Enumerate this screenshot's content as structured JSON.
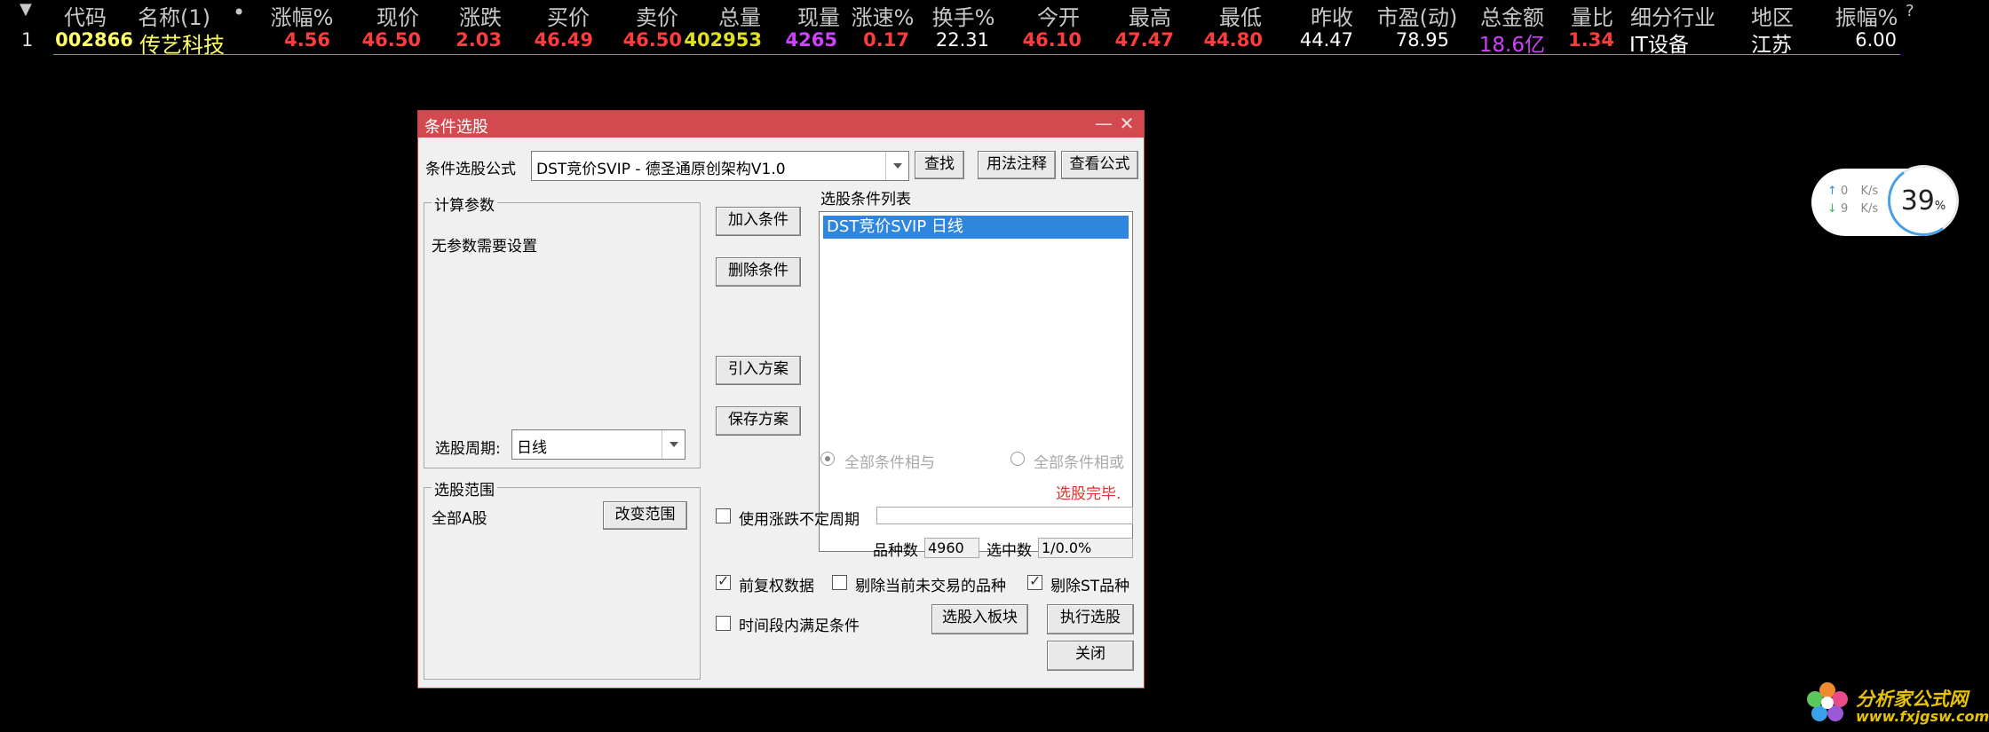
{
  "table": {
    "sort_arrow": "▼",
    "dot": "•",
    "help": "?",
    "headers": [
      "代码",
      "名称(1)",
      "涨幅%",
      "现价",
      "涨跌",
      "买价",
      "卖价",
      "总量",
      "现量",
      "涨速%",
      "换手%",
      "今开",
      "最高",
      "最低",
      "昨收",
      "市盈(动)",
      "总金额",
      "量比",
      "细分行业",
      "地区",
      "振幅%"
    ],
    "row": [
      "1",
      "002866",
      "传艺科技",
      "4.56",
      "46.50",
      "2.03",
      "46.49",
      "46.50",
      "402953",
      "4265",
      "0.17",
      "22.31",
      "46.10",
      "47.47",
      "44.80",
      "44.47",
      "78.95",
      "18.6亿",
      "1.34",
      "IT设备",
      "江苏",
      "6.00"
    ]
  },
  "colors": {
    "up": "#ff3c3c",
    "code": "#ffff66",
    "volume": "#e0e020",
    "purple": "#d040ff",
    "white": "#ffffff",
    "title_bar": "#d24a4f",
    "selection": "#2e86de"
  },
  "dialog": {
    "title": "条件选股",
    "minimize": "—",
    "close": "✕",
    "formula_label": "条件选股公式",
    "formula_value": "DST竞价SVIP  - 德圣通原创架构V1.0",
    "btn_find": "查找",
    "btn_usage": "用法注释",
    "btn_view": "查看公式",
    "params_group": "计算参数",
    "params_text": "无参数需要设置",
    "period_label": "选股周期:",
    "period_value": "日线",
    "range_group": "选股范围",
    "range_value": "全部A股",
    "btn_change_range": "改变范围",
    "btn_add": "加入条件",
    "btn_delete": "删除条件",
    "btn_import": "引入方案",
    "btn_save": "保存方案",
    "list_label": "选股条件列表",
    "list_items": [
      "DST竞价SVIP  日线"
    ],
    "radio_and": "全部条件相与",
    "radio_or": "全部条件相或",
    "status": "选股完毕.",
    "use_period_label": "使用涨跌不定周期",
    "count_label": "品种数",
    "count_value": "4960",
    "selected_label": "选中数",
    "selected_value": "1/0.0%",
    "chk_adjust": "前复权数据",
    "chk_remove_untraded": "剔除当前未交易的品种",
    "chk_remove_st": "剔除ST品种",
    "chk_time": "时间段内满足条件",
    "btn_to_block": "选股入板块",
    "btn_execute": "执行选股",
    "btn_close": "关闭"
  },
  "speed_widget": {
    "up_value": "0",
    "down_value": "9",
    "unit": "K/s",
    "up_arrow": "↑",
    "down_arrow": "↓",
    "percent": "39",
    "percent_sign": "%"
  },
  "watermark": {
    "name": "分析家公式网",
    "url": "www.fxjgsw.com"
  }
}
